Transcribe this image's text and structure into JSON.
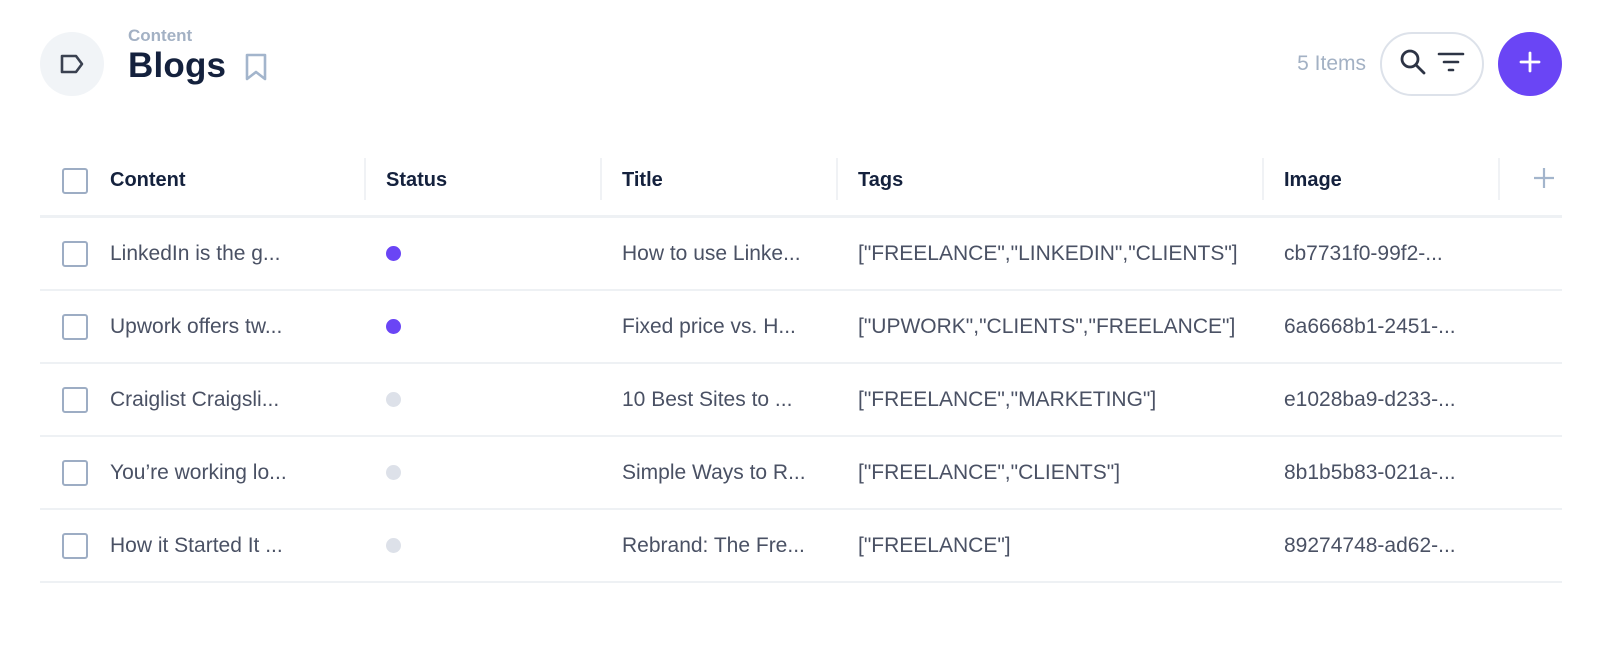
{
  "header": {
    "breadcrumb": "Content",
    "title": "Blogs",
    "item_count": "5 Items",
    "icons": {
      "collection": "tag-icon",
      "bookmark": "bookmark-icon",
      "search": "search-icon",
      "filter": "filter-icon",
      "add": "plus-icon"
    }
  },
  "colors": {
    "accent": "#6a45f5",
    "status_published": "#6a45f5",
    "status_draft": "#dde1e9"
  },
  "table": {
    "columns": [
      "Content",
      "Status",
      "Title",
      "Tags",
      "Image"
    ],
    "add_column_icon": "plus-icon",
    "rows": [
      {
        "content": "LinkedIn is the g...",
        "status": "published",
        "title": "How to use Linke...",
        "tags": "[\"FREELANCE\",\"LINKEDIN\",\"CLIENTS\"]",
        "image": "cb7731f0-99f2-..."
      },
      {
        "content": "Upwork offers tw...",
        "status": "published",
        "title": "Fixed price vs. H...",
        "tags": "[\"UPWORK\",\"CLIENTS\",\"FREELANCE\"]",
        "image": "6a6668b1-2451-..."
      },
      {
        "content": "Craiglist Craigsli...",
        "status": "draft",
        "title": "10 Best Sites to ...",
        "tags": "[\"FREELANCE\",\"MARKETING\"]",
        "image": "e1028ba9-d233-..."
      },
      {
        "content": "You’re working lo...",
        "status": "draft",
        "title": "Simple Ways to R...",
        "tags": "[\"FREELANCE\",\"CLIENTS\"]",
        "image": "8b1b5b83-021a-..."
      },
      {
        "content": "How it Started It ...",
        "status": "draft",
        "title": "Rebrand: The Fre...",
        "tags": "[\"FREELANCE\"]",
        "image": "89274748-ad62-..."
      }
    ]
  }
}
